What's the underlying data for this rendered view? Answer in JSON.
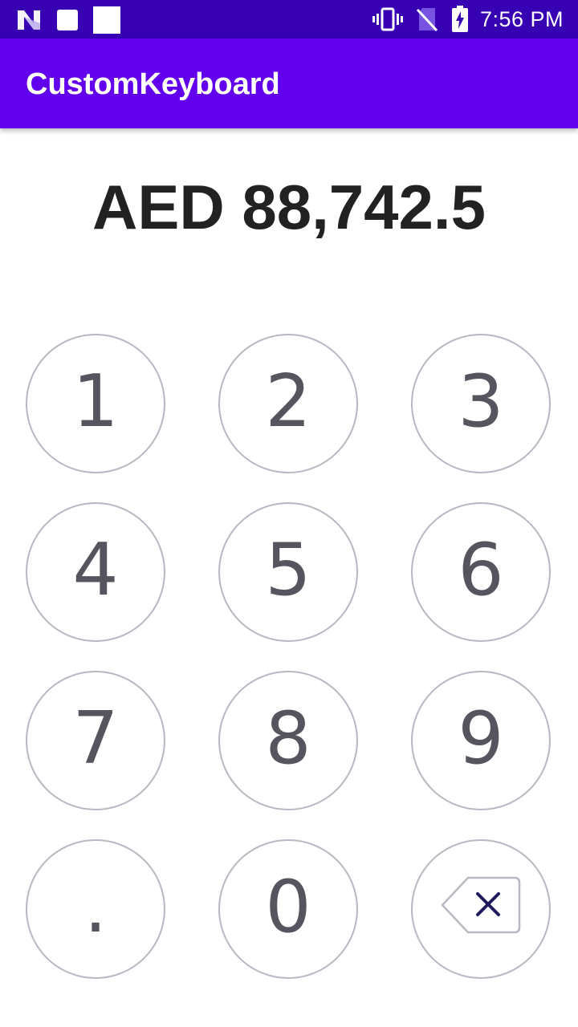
{
  "status_bar": {
    "time": "7:56 PM",
    "icons": [
      "notification-n-icon",
      "square-icon",
      "square-icon",
      "vibrate-icon",
      "no-sim-icon",
      "battery-charging-icon"
    ]
  },
  "app_bar": {
    "title": "CustomKeyboard"
  },
  "amount_display": "AED 88,742.5",
  "keypad": {
    "keys": [
      "1",
      "2",
      "3",
      "4",
      "5",
      "6",
      "7",
      "8",
      "9",
      ".",
      "0"
    ],
    "backspace_icon": "backspace-icon"
  },
  "colors": {
    "status_bar": "#3700b3",
    "app_bar": "#6200ee",
    "key_border": "#b8b8c4",
    "key_text": "#55555f",
    "backspace_x": "#1f1b5c"
  }
}
